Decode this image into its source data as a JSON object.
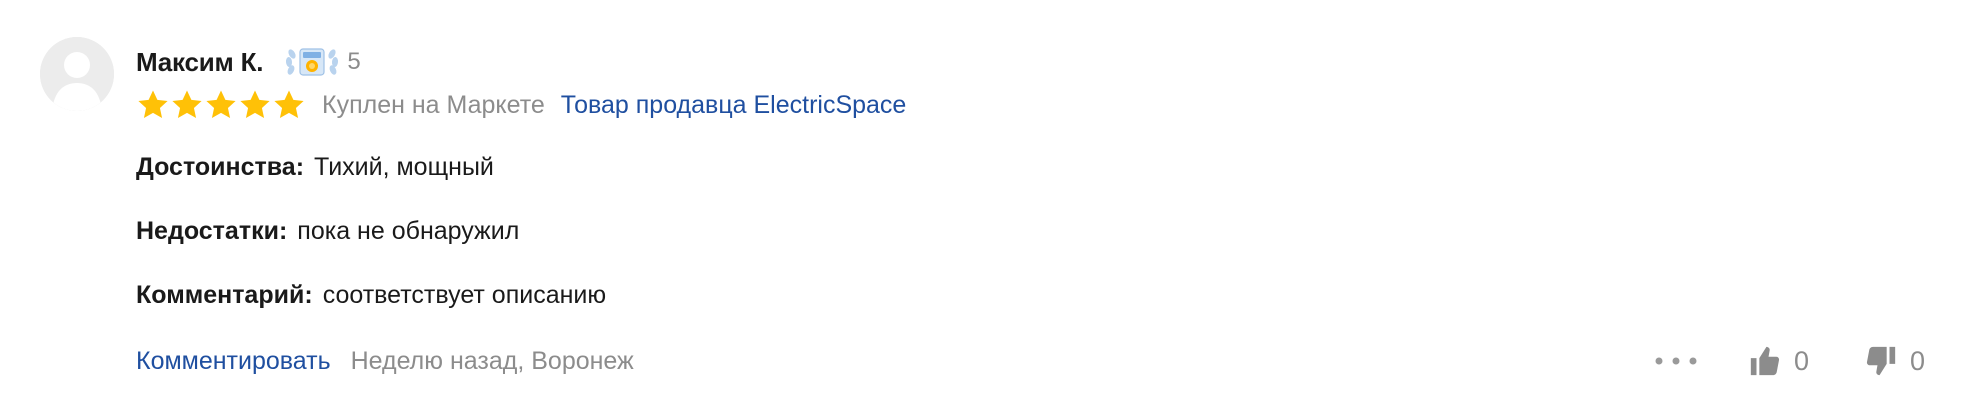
{
  "review": {
    "author": {
      "name": "Максим К.",
      "badge_icon": "achievement-laurel-icon",
      "badge_count": "5"
    },
    "rating": {
      "stars": 5,
      "max_stars": 5,
      "star_color": "#ffc107"
    },
    "bought_label": "Куплен на Маркете",
    "seller_link": "Товар продавца ElectricSpace",
    "pros": {
      "label": "Достоинства:",
      "value": "Тихий, мощный"
    },
    "cons": {
      "label": "Недостатки:",
      "value": "пока не обнаружил"
    },
    "comment": {
      "label": "Комментарий:",
      "value": "соответствует описанию"
    },
    "footer": {
      "comment_action": "Комментировать",
      "meta": "Неделю назад, Воронеж"
    },
    "votes": {
      "likes": "0",
      "dislikes": "0"
    }
  },
  "colors": {
    "link": "#1f4fa0",
    "muted": "#8c8c8c",
    "text": "#1a1a1a",
    "star": "#ffc107"
  },
  "icons": {
    "avatar": "user-avatar-placeholder",
    "star": "star-icon",
    "more": "more-dots-icon",
    "like": "thumbs-up-icon",
    "dislike": "thumbs-down-icon"
  }
}
